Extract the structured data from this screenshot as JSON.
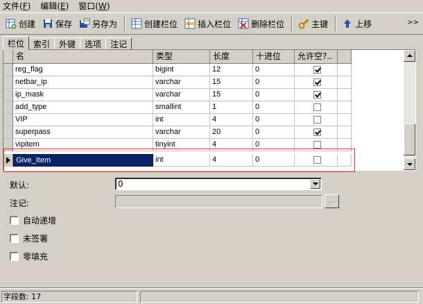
{
  "menu": [
    {
      "label": "文件",
      "accel": "F"
    },
    {
      "label": "编辑",
      "accel": "E"
    },
    {
      "label": "窗口",
      "accel": "W"
    }
  ],
  "toolbar": {
    "create": "创建",
    "save": "保存",
    "save_as": "另存为",
    "create_field": "创建栏位",
    "insert_field": "插入栏位",
    "delete_field": "删除栏位",
    "primary_key": "主键",
    "move_up": "上移",
    "more": ">>"
  },
  "tabs": [
    "栏位",
    "索引",
    "外键",
    "选项",
    "注记"
  ],
  "grid": {
    "headers": [
      "名",
      "类型",
      "长度",
      "十进位",
      "允许空?.."
    ],
    "rows": [
      {
        "name": "reg_flag",
        "type": "bigint",
        "length": "12",
        "decimals": "0",
        "nullable": true
      },
      {
        "name": "netbar_ip",
        "type": "varchar",
        "length": "15",
        "decimals": "0",
        "nullable": true
      },
      {
        "name": "ip_mask",
        "type": "varchar",
        "length": "15",
        "decimals": "0",
        "nullable": true
      },
      {
        "name": "add_type",
        "type": "smallint",
        "length": "1",
        "decimals": "0",
        "nullable": false
      },
      {
        "name": "VIP",
        "type": "int",
        "length": "4",
        "decimals": "0",
        "nullable": false
      },
      {
        "name": "superpass",
        "type": "varchar",
        "length": "20",
        "decimals": "0",
        "nullable": true
      },
      {
        "name": "vipitem",
        "type": "tinyint",
        "length": "4",
        "decimals": "0",
        "nullable": false
      },
      {
        "name": "Give_Item",
        "type": "int",
        "length": "4",
        "decimals": "0",
        "nullable": false
      }
    ]
  },
  "properties": {
    "default_label": "默认:",
    "default_value": "0",
    "comment_label": "注记:",
    "comment_button": "...",
    "auto_increment": "自动递增",
    "unsigned": "未签署",
    "zerofill": "零填充"
  },
  "status": {
    "field_count": "字段数: 17"
  }
}
